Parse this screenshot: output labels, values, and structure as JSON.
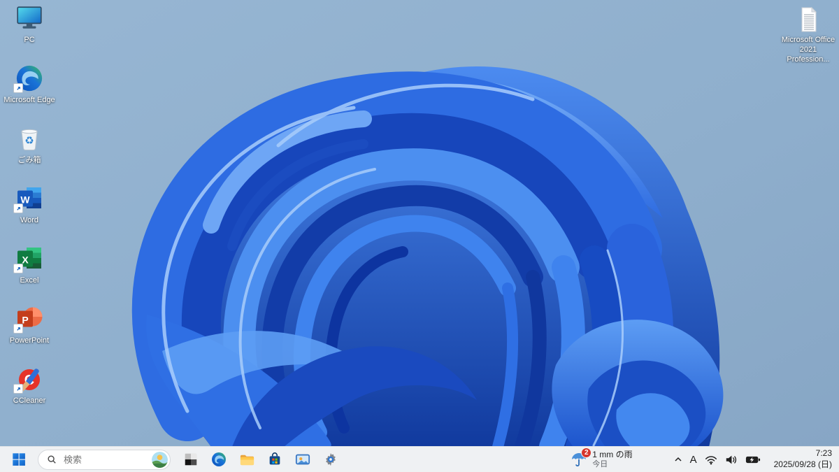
{
  "desktop": {
    "icons": [
      {
        "label": "PC"
      },
      {
        "label": "Microsoft Edge"
      },
      {
        "label": "ごみ箱",
        "glyph": "♻"
      },
      {
        "label": "Word",
        "letter": "W"
      },
      {
        "label": "Excel",
        "letter": "X"
      },
      {
        "label": "PowerPoint",
        "letter": "P"
      },
      {
        "label": "CCleaner",
        "letter": "C"
      }
    ],
    "office_file": {
      "line1": "Microsoft Office",
      "line2": "2021 Profession..."
    }
  },
  "taskbar": {
    "search_placeholder": "検索",
    "pinned_apps": [
      "pinned-app",
      "microsoft-edge",
      "file-explorer",
      "microsoft-store",
      "image-viewer",
      "settings"
    ],
    "weather": {
      "badge": "2",
      "line1": "1 mm の雨",
      "line2": "今日"
    },
    "tray": {
      "ime": "A"
    },
    "clock": {
      "time": "7:23",
      "date": "2025/09/28 (日)"
    }
  },
  "colors": {
    "accent": "#1272d9",
    "taskbar_bg": "#eff1f3",
    "badge_red": "#d7352b",
    "wallpaper_blue_dark": "#113a9e",
    "wallpaper_blue_mid": "#2e6ce2",
    "wallpaper_blue_light": "#5d9df4",
    "wallpaper_sky": "#93b3d0"
  }
}
